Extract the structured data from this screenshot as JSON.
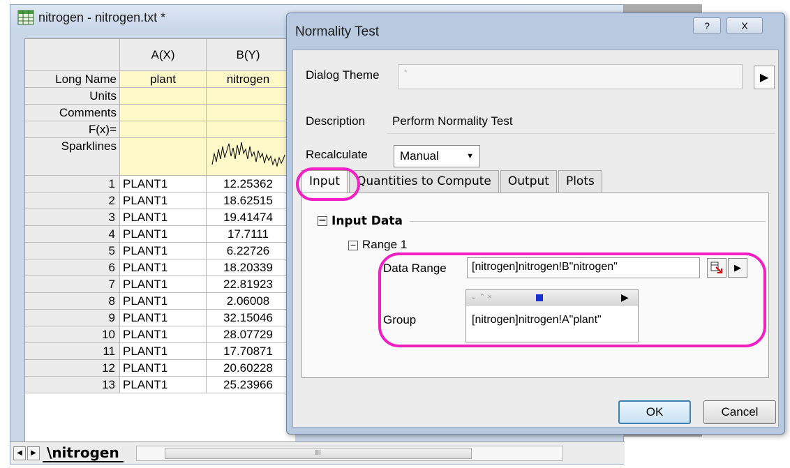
{
  "worksheet": {
    "title": "nitrogen - nitrogen.txt *",
    "columns": [
      {
        "header": "A(X)",
        "long_name": "plant"
      },
      {
        "header": "B(Y)",
        "long_name": "nitrogen"
      }
    ],
    "row_labels": {
      "long_name": "Long Name",
      "units": "Units",
      "comments": "Comments",
      "fx": "F(x)=",
      "sparklines": "Sparklines"
    },
    "rows": [
      {
        "n": "1",
        "a": "PLANT1",
        "b": "12.25362"
      },
      {
        "n": "2",
        "a": "PLANT1",
        "b": "18.62515"
      },
      {
        "n": "3",
        "a": "PLANT1",
        "b": "19.41474"
      },
      {
        "n": "4",
        "a": "PLANT1",
        "b": "17.7111"
      },
      {
        "n": "5",
        "a": "PLANT1",
        "b": "6.22726"
      },
      {
        "n": "6",
        "a": "PLANT1",
        "b": "18.20339"
      },
      {
        "n": "7",
        "a": "PLANT1",
        "b": "22.81923"
      },
      {
        "n": "8",
        "a": "PLANT1",
        "b": "2.06008"
      },
      {
        "n": "9",
        "a": "PLANT1",
        "b": "32.15046"
      },
      {
        "n": "10",
        "a": "PLANT1",
        "b": "28.07729"
      },
      {
        "n": "11",
        "a": "PLANT1",
        "b": "17.70871"
      },
      {
        "n": "12",
        "a": "PLANT1",
        "b": "20.60228"
      },
      {
        "n": "13",
        "a": "PLANT1",
        "b": "25.23966"
      }
    ],
    "sheet_tab": "nitrogen",
    "scroll_thumb": "III"
  },
  "dialog": {
    "title": "Normality Test",
    "help_glyph": "?",
    "close_glyph": "X",
    "dialog_theme_label": "Dialog Theme",
    "dialog_theme_value": "*",
    "description_label": "Description",
    "description_value": "Perform Normality Test",
    "recalculate_label": "Recalculate",
    "recalculate_value": "Manual",
    "tabs": [
      "Input",
      "Quantities to Compute",
      "Output",
      "Plots"
    ],
    "input_data_label": "Input Data",
    "range_label": "Range 1",
    "data_range_label": "Data Range",
    "data_range_value": "[nitrogen]nitrogen!B\"nitrogen\"",
    "group_label": "Group",
    "group_value": "[nitrogen]nitrogen!A\"plant\"",
    "ok_label": "OK",
    "cancel_label": "Cancel"
  },
  "colors": {
    "annotation": "#f21fc4",
    "metadata_cell": "#fff8c8",
    "dialog_frame": "#b9c9df"
  },
  "icons": [
    "worksheet-icon",
    "help-icon",
    "close-icon",
    "play-arrow-icon",
    "range-select-icon",
    "collapse-icon",
    "dropdown-arrow-icon"
  ]
}
